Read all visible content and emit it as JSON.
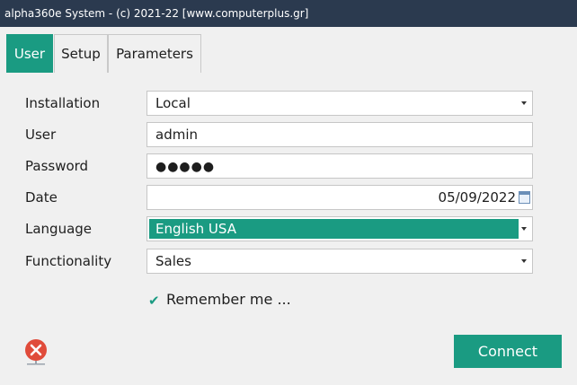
{
  "window": {
    "title": "alpha360e System - (c) 2021-22 [www.computerplus.gr]"
  },
  "tabs": [
    {
      "label": "User",
      "active": true
    },
    {
      "label": "Setup",
      "active": false
    },
    {
      "label": "Parameters",
      "active": false
    }
  ],
  "form": {
    "installation": {
      "label": "Installation",
      "value": "Local"
    },
    "user": {
      "label": "User",
      "value": "admin"
    },
    "password": {
      "label": "Password",
      "value": "●●●●●"
    },
    "date": {
      "label": "Date",
      "value": "05/09/2022"
    },
    "language": {
      "label": "Language",
      "value": "English USA"
    },
    "functionality": {
      "label": "Functionality",
      "value": "Sales"
    }
  },
  "remember": {
    "label": "Remember me ...",
    "checked": true
  },
  "actions": {
    "connect_label": "Connect",
    "close_icon": "close-icon"
  },
  "colors": {
    "accent": "#1a9b82",
    "titlebar": "#2b3a4f",
    "close": "#e04b3a"
  }
}
